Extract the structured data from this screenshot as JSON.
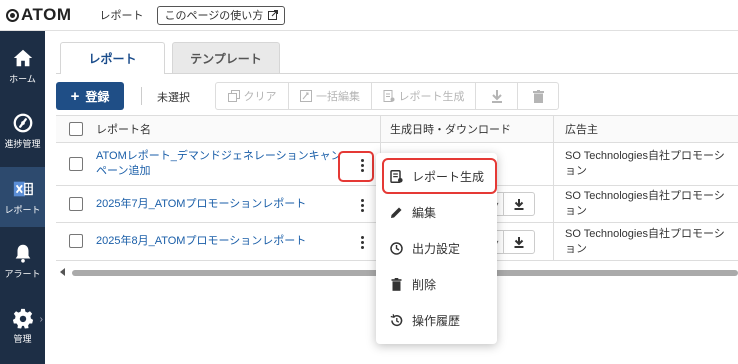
{
  "header": {
    "logo_text": "ATOM",
    "breadcrumb": "レポート",
    "help_label": "このページの使い方"
  },
  "sidebar": {
    "items": [
      {
        "label": "ホーム",
        "icon": "home-icon"
      },
      {
        "label": "進捗管理",
        "icon": "progress-icon"
      },
      {
        "label": "レポート",
        "icon": "excel-report-icon",
        "active": true
      },
      {
        "label": "アラート",
        "icon": "bell-icon"
      },
      {
        "label": "管理",
        "icon": "gear-icon"
      }
    ]
  },
  "tabs": [
    {
      "label": "レポート",
      "active": true
    },
    {
      "label": "テンプレート",
      "active": false
    }
  ],
  "toolbar": {
    "register_label": "登録",
    "selection_status": "未選択",
    "clear_label": "クリア",
    "bulk_edit_label": "一括編集",
    "generate_label": "レポート生成"
  },
  "table": {
    "columns": [
      "レポート名",
      "生成日時・ダウンロード",
      "広告主"
    ],
    "rows": [
      {
        "name": "ATOMレポート_デマンドジェネレーションキャンペーン追加",
        "advertiser": "SO Technologies自社プロモーション"
      },
      {
        "name": "2025年7月_ATOMプロモーションレポート",
        "advertiser": "SO Technologies自社プロモーション"
      },
      {
        "name": "2025年8月_ATOMプロモーションレポート",
        "advertiser": "SO Technologies自社プロモーション"
      }
    ]
  },
  "context_menu": {
    "items": [
      {
        "label": "レポート生成",
        "icon": "report-generate-icon"
      },
      {
        "label": "編集",
        "icon": "pencil-icon"
      },
      {
        "label": "出力設定",
        "icon": "clock-icon"
      },
      {
        "label": "削除",
        "icon": "trash-icon"
      },
      {
        "label": "操作履歴",
        "icon": "history-icon"
      }
    ]
  },
  "colors": {
    "sidebar_bg": "#1d2e45",
    "sidebar_active": "#2d4a6e",
    "primary": "#1f4e86",
    "link": "#1a5ea8",
    "highlight": "#e53935"
  }
}
